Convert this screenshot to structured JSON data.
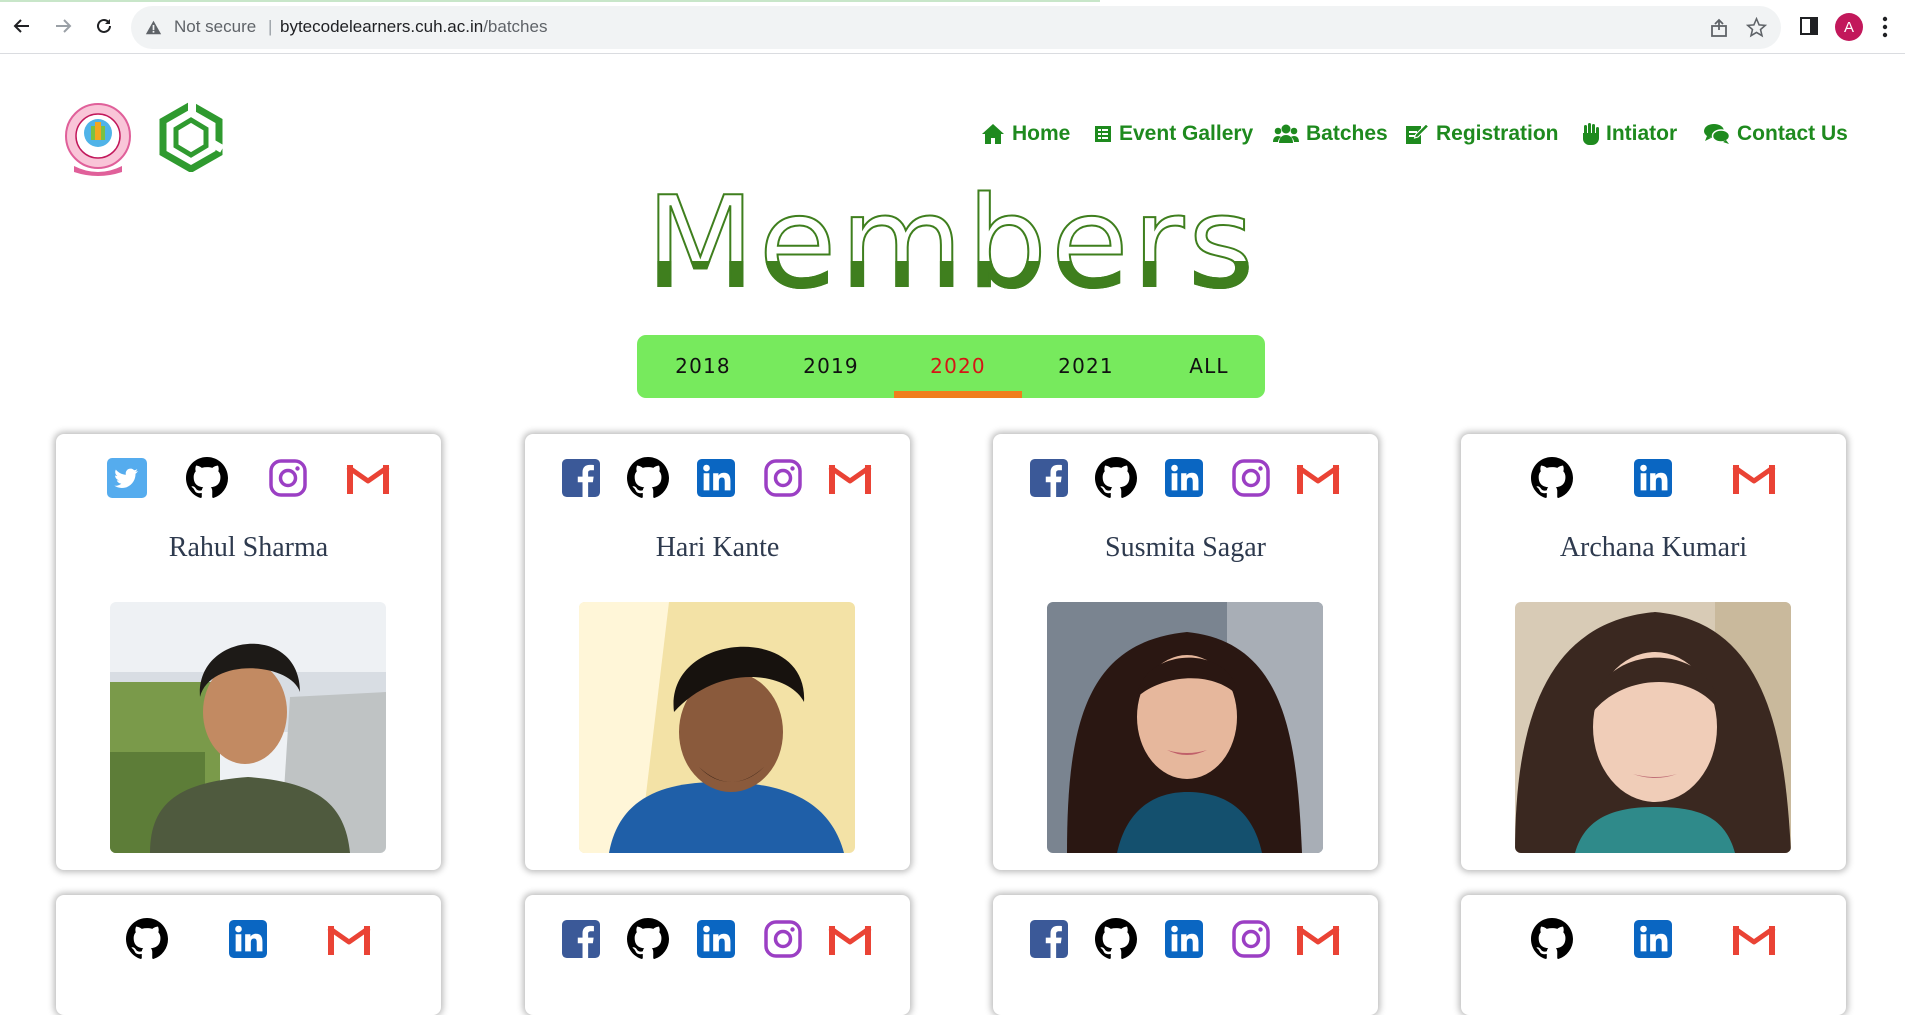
{
  "browser": {
    "security_text": "Not secure",
    "separator": "|",
    "url_host": "bytecodelearners.cuh.ac.in",
    "url_path": "/batches",
    "profile_initial": "A"
  },
  "nav": {
    "items": [
      {
        "label": "Home",
        "icon": "home-icon"
      },
      {
        "label": "Event Gallery",
        "icon": "gallery-icon"
      },
      {
        "label": "Batches",
        "icon": "users-icon"
      },
      {
        "label": "Registration",
        "icon": "edit-form-icon"
      },
      {
        "label": "Intiator",
        "icon": "hand-icon"
      },
      {
        "label": "Contact Us",
        "icon": "chat-icon"
      }
    ]
  },
  "page_title": "Members",
  "tabs": {
    "items": [
      "2018",
      "2019",
      "2020",
      "2021",
      "ALL"
    ],
    "active": "2020"
  },
  "members": [
    {
      "name": "Rahul Sharma",
      "socials": [
        "twitter",
        "github",
        "instagram",
        "gmail"
      ]
    },
    {
      "name": "Hari Kante",
      "socials": [
        "facebook",
        "github",
        "linkedin",
        "instagram",
        "gmail"
      ]
    },
    {
      "name": "Susmita Sagar",
      "socials": [
        "facebook",
        "github",
        "linkedin",
        "instagram",
        "gmail"
      ]
    },
    {
      "name": "Archana Kumari",
      "socials": [
        "github",
        "linkedin",
        "gmail"
      ]
    }
  ],
  "members_row2": [
    {
      "socials": [
        "github",
        "linkedin",
        "gmail"
      ]
    },
    {
      "socials": [
        "facebook",
        "github",
        "linkedin",
        "instagram",
        "gmail"
      ]
    },
    {
      "socials": [
        "facebook",
        "github",
        "linkedin",
        "instagram",
        "gmail"
      ]
    },
    {
      "socials": [
        "github",
        "linkedin",
        "gmail"
      ]
    }
  ],
  "colors": {
    "nav_green": "#1e8a1e",
    "title_green": "#3f7f1e",
    "tab_bg": "#77ea5d",
    "tab_active_text": "#d51515",
    "tab_underline": "#f07d1d",
    "facebook": "#3b5998",
    "twitter": "#55acee",
    "linkedin": "#0a66c2",
    "instagram": "#9b3fc4",
    "gmail": "#ea4335",
    "github": "#000000"
  }
}
